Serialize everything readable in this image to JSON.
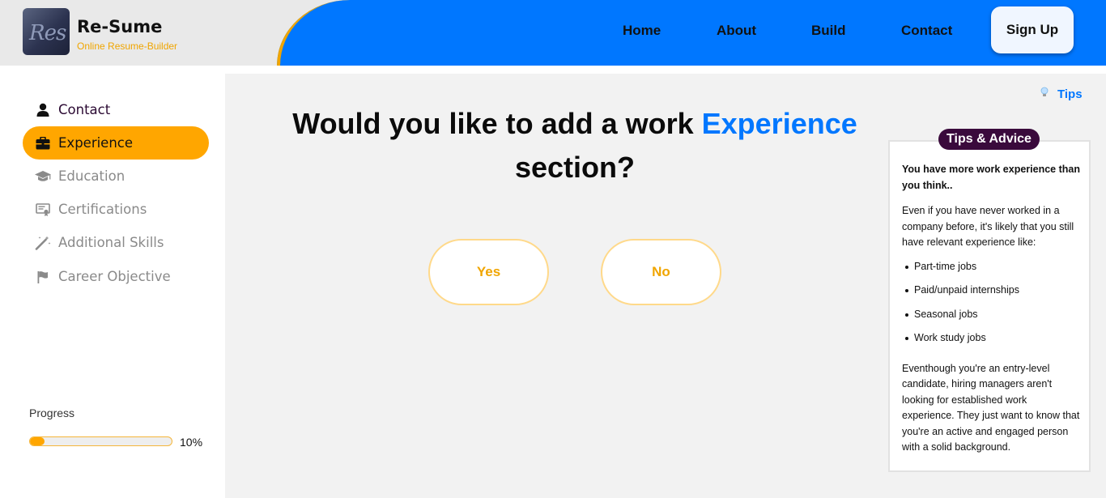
{
  "brand": {
    "logo_text": "Res",
    "name": "Re-Sume",
    "tagline": "Online Resume-Builder"
  },
  "nav": {
    "home": "Home",
    "about": "About",
    "build": "Build",
    "contact": "Contact",
    "signup": "Sign Up"
  },
  "sidebar": {
    "items": [
      {
        "label": "Contact",
        "icon": "user-icon",
        "state": "done"
      },
      {
        "label": "Experience",
        "icon": "briefcase-icon",
        "state": "active"
      },
      {
        "label": "Education",
        "icon": "graduation-cap-icon",
        "state": "todo"
      },
      {
        "label": "Certifications",
        "icon": "certificate-icon",
        "state": "todo"
      },
      {
        "label": "Additional Skills",
        "icon": "magic-wand-icon",
        "state": "todo"
      },
      {
        "label": "Career Objective",
        "icon": "flag-icon",
        "state": "todo"
      }
    ],
    "progress": {
      "label": "Progress",
      "value_text": "10%",
      "value": 0.1
    }
  },
  "question": {
    "before": "Would you like to add a work",
    "highlight": "Experience",
    "after": "section?"
  },
  "answers": {
    "yes": "Yes",
    "no": "No"
  },
  "tips": {
    "link_label": "Tips",
    "badge": "Tips & Advice",
    "heading": "You have more work experience than you think..",
    "intro": "Even if you have never worked in a company before, it's likely that you still have relevant experience like:",
    "list": [
      "Part-time jobs",
      "Paid/unpaid internships",
      "Seasonal jobs",
      "Work study jobs"
    ],
    "outro": "Eventhough you're an entry-level candidate, hiring managers aren't looking for established work experience. They just want to know that you're an active and engaged person with a solid background."
  },
  "colors": {
    "accent_blue": "#0077ff",
    "accent_orange": "#ffa600",
    "badge_purple": "#3a0a3c"
  }
}
